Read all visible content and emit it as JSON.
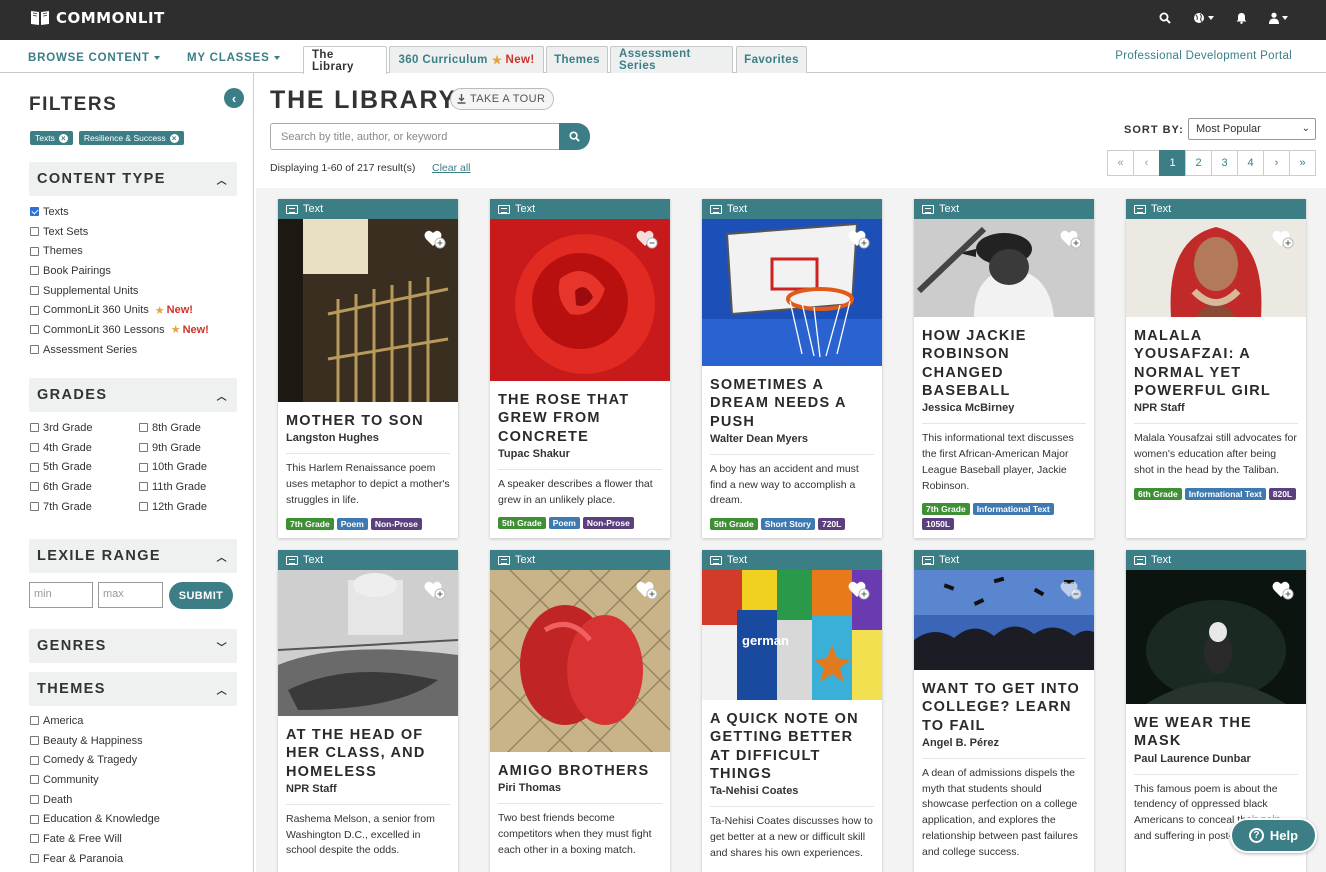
{
  "app": {
    "logo_text": "COMMONLIT"
  },
  "nav": {
    "browse": "BROWSE CONTENT",
    "classes": "MY CLASSES",
    "tabs": [
      {
        "label": "The Library",
        "active": true
      },
      {
        "label": "360 Curriculum",
        "new": "New!"
      },
      {
        "label": "Themes"
      },
      {
        "label": "Assessment Series"
      },
      {
        "label": "Favorites"
      }
    ],
    "pd_link": "Professional Development Portal"
  },
  "sidebar": {
    "title": "FILTERS",
    "chips": [
      "Texts",
      "Resilience & Success"
    ],
    "content_type": {
      "title": "CONTENT TYPE",
      "items": [
        {
          "label": "Texts",
          "checked": true
        },
        {
          "label": "Text Sets"
        },
        {
          "label": "Themes"
        },
        {
          "label": "Book Pairings"
        },
        {
          "label": "Supplemental Units"
        },
        {
          "label": "CommonLit 360 Units",
          "new": "New!"
        },
        {
          "label": "CommonLit 360 Lessons",
          "new": "New!"
        },
        {
          "label": "Assessment Series"
        }
      ]
    },
    "grades": {
      "title": "GRADES",
      "items": [
        "3rd Grade",
        "8th Grade",
        "4th Grade",
        "9th Grade",
        "5th Grade",
        "10th Grade",
        "6th Grade",
        "11th Grade",
        "7th Grade",
        "12th Grade"
      ]
    },
    "lexile": {
      "title": "LEXILE RANGE",
      "min_placeholder": "min",
      "max_placeholder": "max",
      "submit": "SUBMIT"
    },
    "genres": {
      "title": "GENRES"
    },
    "themes": {
      "title": "THEMES",
      "items": [
        "America",
        "Beauty & Happiness",
        "Comedy & Tragedy",
        "Community",
        "Death",
        "Education & Knowledge",
        "Fate & Free Will",
        "Fear & Paranoia"
      ]
    }
  },
  "main": {
    "title": "THE LIBRARY",
    "tour": "TAKE A TOUR",
    "search_placeholder": "Search by title, author, or keyword",
    "result_count": "Displaying 1-60 of 217 result(s)",
    "clear_all": "Clear all",
    "sort_label": "SORT BY:",
    "sort_value": "Most Popular",
    "pages": [
      "«",
      "‹",
      "1",
      "2",
      "3",
      "4",
      "›",
      "»"
    ],
    "current_page": "1"
  },
  "cards": [
    {
      "type": "Text",
      "title": "MOTHER TO SON",
      "author": "Langston Hughes",
      "desc": "This Harlem Renaissance poem uses metaphor to depict a mother's struggles in life.",
      "tags": [
        [
          "7th Grade",
          "grade"
        ],
        [
          "Poem",
          "genre"
        ],
        [
          "Non-Prose",
          "np"
        ]
      ]
    },
    {
      "type": "Text",
      "title": "THE ROSE THAT GREW FROM CONCRETE",
      "author": "Tupac Shakur",
      "desc": "A speaker describes a flower that grew in an unlikely place.",
      "tags": [
        [
          "5th Grade",
          "grade"
        ],
        [
          "Poem",
          "genre"
        ],
        [
          "Non-Prose",
          "np"
        ]
      ]
    },
    {
      "type": "Text",
      "title": "SOMETIMES A DREAM NEEDS A PUSH",
      "author": "Walter Dean Myers",
      "desc": "A boy has an accident and must find a new way to accomplish a dream.",
      "tags": [
        [
          "5th Grade",
          "grade"
        ],
        [
          "Short Story",
          "genre"
        ],
        [
          "720L",
          "lex"
        ]
      ]
    },
    {
      "type": "Text",
      "title": "HOW JACKIE ROBINSON CHANGED BASEBALL",
      "author": "Jessica McBirney",
      "desc": "This informational text discusses the first African-American Major League Baseball player, Jackie Robinson.",
      "tags": [
        [
          "7th Grade",
          "grade"
        ],
        [
          "Informational Text",
          "genre"
        ],
        [
          "1050L",
          "lex"
        ]
      ]
    },
    {
      "type": "Text",
      "title": "MALALA YOUSAFZAI: A NORMAL YET POWERFUL GIRL",
      "author": "NPR Staff",
      "desc": "Malala Yousafzai still advocates for women's education after being shot in the head by the Taliban.",
      "tags": [
        [
          "6th Grade",
          "grade"
        ],
        [
          "Informational Text",
          "genre"
        ],
        [
          "820L",
          "lex"
        ]
      ]
    },
    {
      "type": "Text",
      "title": "AT THE HEAD OF HER CLASS, AND HOMELESS",
      "author": "NPR Staff",
      "desc": "Rashema Melson, a senior from Washington D.C., excelled in school despite the odds.",
      "tags": []
    },
    {
      "type": "Text",
      "title": "AMIGO BROTHERS",
      "author": "Piri Thomas",
      "desc": "Two best friends become competitors when they must fight each other in a boxing match.",
      "tags": []
    },
    {
      "type": "Text",
      "title": "A QUICK NOTE ON GETTING BETTER AT DIFFICULT THINGS",
      "author": "Ta-Nehisi Coates",
      "desc": "Ta-Nehisi Coates discusses how to get better at a new or difficult skill and shares his own experiences.",
      "tags": []
    },
    {
      "type": "Text",
      "title": "WANT TO GET INTO COLLEGE? LEARN TO FAIL",
      "author": "Angel B. Pérez",
      "desc": "A dean of admissions dispels the myth that students should showcase perfection on a college application, and explores the relationship between past failures and college success.",
      "tags": []
    },
    {
      "type": "Text",
      "title": "WE WEAR THE MASK",
      "author": "Paul Laurence Dunbar",
      "desc": "This famous poem is about the tendency of oppressed black Americans to conceal their pain and suffering in post-war America.",
      "tags": []
    }
  ],
  "help": {
    "label": "Help"
  },
  "colors": {
    "accent": "#3b7e86",
    "topbar": "#2e2e2e",
    "grade_tag": "#3f8f35",
    "genre_tag": "#3e7ab0",
    "np_tag": "#5c3f7f"
  }
}
